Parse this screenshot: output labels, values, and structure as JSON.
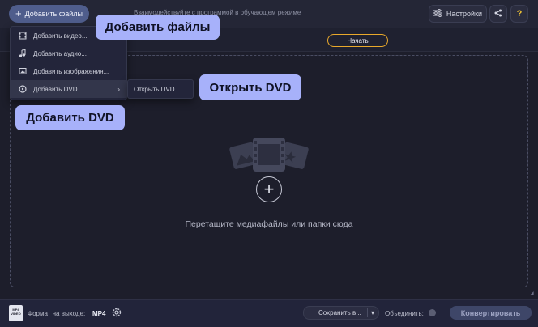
{
  "header": {
    "add_files_label": "Добавить файлы",
    "settings_label": "Настройки",
    "help_label": "?"
  },
  "tutorial": {
    "message": "Взаимодействуйте с программой в обучающем режиме",
    "start_label": "Начать"
  },
  "add_menu": {
    "items": [
      {
        "label": "Добавить видео...",
        "icon": "video-icon"
      },
      {
        "label": "Добавить аудио...",
        "icon": "audio-icon"
      },
      {
        "label": "Добавить изображения...",
        "icon": "image-icon"
      },
      {
        "label": "Добавить DVD",
        "icon": "dvd-icon",
        "has_submenu": true,
        "arrow": "›"
      }
    ],
    "submenu": {
      "open_dvd_label": "Открыть DVD..."
    }
  },
  "callouts": {
    "add_files": "Добавить файлы",
    "open_dvd": "Открыть DVD",
    "add_dvd": "Добавить DVD"
  },
  "drop_zone": {
    "hint": "Перетащите медиафайлы или папки сюда",
    "plus_symbol": "+"
  },
  "footer": {
    "format_icon_text": "MP4 VIDEO",
    "output_format_label": "Формат на выходе:",
    "output_format_value": "MP4",
    "save_label": "Сохранить в...",
    "merge_label": "Объединить:",
    "convert_label": "Конвертировать"
  },
  "colors": {
    "background": "#1d1e2b",
    "accent": "#a7b1fa",
    "start_border": "#e9a92b",
    "help_color": "#f2c534"
  }
}
